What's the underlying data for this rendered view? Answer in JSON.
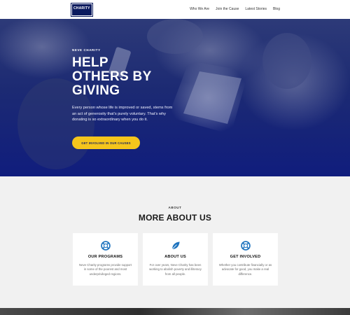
{
  "header": {
    "logo_text": "CHARITY",
    "nav": [
      "Who We Are",
      "Join the Cause",
      "Latest Stories",
      "Blog"
    ]
  },
  "hero": {
    "eyebrow": "NEVE CHARITY",
    "title_line1": "HELP",
    "title_line2": "OTHERS BY",
    "title_line3": "GIVING",
    "text": "Every person whose life is improved or saved, stems from an act of generosity that’s purely voluntary. That’s why donating is so extraordinary when you do it.",
    "cta_label": "GET INVOLVED IN OUR CAUSES"
  },
  "about": {
    "eyebrow": "ABOUT",
    "title": "MORE ABOUT US",
    "cards": [
      {
        "icon": "lifebuoy-icon",
        "title": "OUR PROGRAMS",
        "text": "Neve Charity programs provide support in some of the poorest and most underprivileged regions."
      },
      {
        "icon": "leaf-icon",
        "title": "ABOUT US",
        "text": "For over years, Neve Charity has been working to abolish poverty and illiteracy from all people."
      },
      {
        "icon": "lifebuoy-icon",
        "title": "GET INVOLVED",
        "text": "Whether you contribute financially or as advocate for good, you make a real difference."
      }
    ]
  },
  "colors": {
    "brand_navy": "#0b1a5e",
    "hero_blue": "#101d7d",
    "cta_yellow": "#f5c51c",
    "icon_blue": "#1e73be"
  }
}
